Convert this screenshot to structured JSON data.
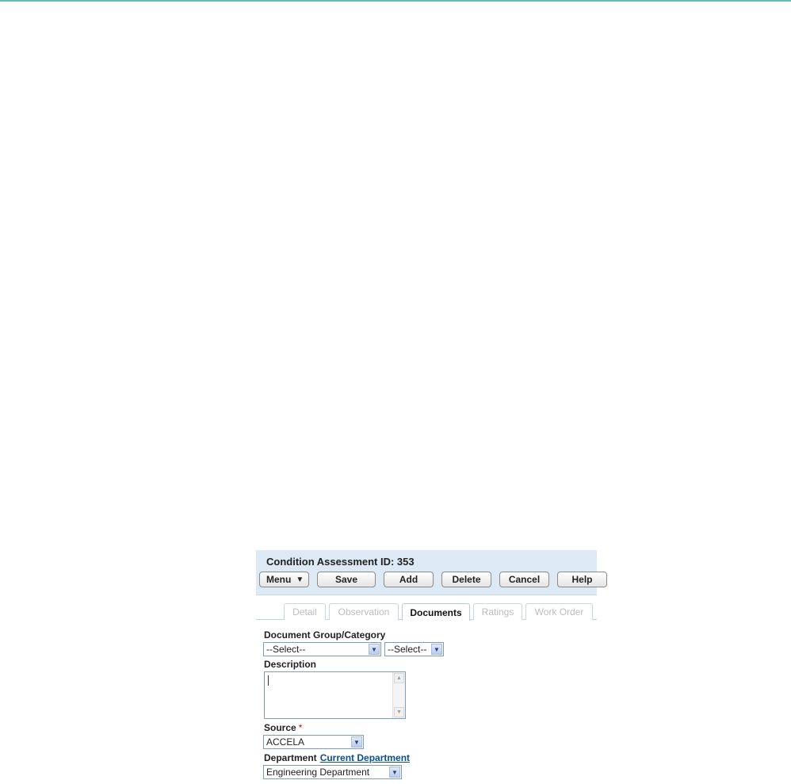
{
  "header": {
    "title": "Condition Assessment ID: 353"
  },
  "toolbar": {
    "menu_label": "Menu",
    "menu_icon": "double-chevron-down-icon",
    "save_label": "Save",
    "add_label": "Add",
    "delete_label": "Delete",
    "cancel_label": "Cancel",
    "help_label": "Help"
  },
  "tabs": [
    {
      "label": "Detail",
      "active": false
    },
    {
      "label": "Observation",
      "active": false
    },
    {
      "label": "Documents",
      "active": true
    },
    {
      "label": "Ratings",
      "active": false
    },
    {
      "label": "Work Order",
      "active": false
    }
  ],
  "form": {
    "doc_group_label": "Document Group/Category",
    "group_value": "--Select--",
    "category_value": "--Select--",
    "description_label": "Description",
    "description_value": "",
    "source_label": "Source",
    "source_required_mark": "*",
    "source_value": "ACCELA",
    "department_label": "Department",
    "department_link": "Current Department",
    "department_value": "Engineering Department"
  },
  "colors": {
    "header_bg": "#dde9f5",
    "link": "#0b4f8a",
    "required": "#cc0000"
  }
}
